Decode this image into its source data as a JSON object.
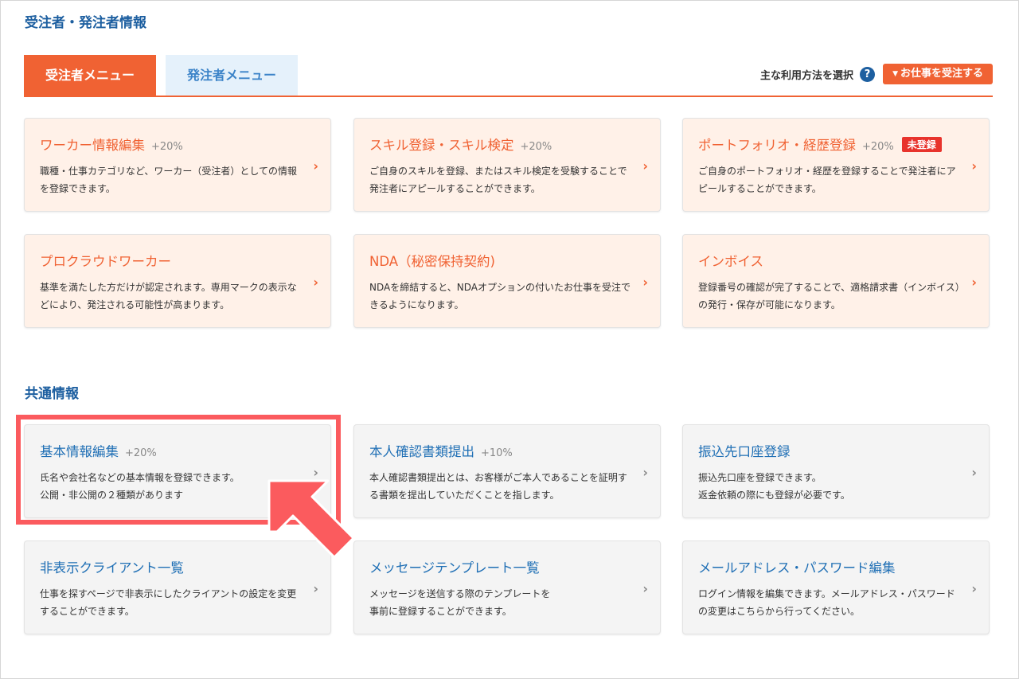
{
  "header": {
    "title": "受注者・発注者情報"
  },
  "tabs": [
    {
      "label": "受注者メニュー",
      "active": true
    },
    {
      "label": "発注者メニュー",
      "active": false
    }
  ],
  "method": {
    "label": "主な利用方法を選択",
    "help_icon": "?",
    "button_caret": "▼",
    "button_label": "お仕事を受注する"
  },
  "worker_cards": [
    {
      "title": "ワーカー情報編集",
      "pct": "+20%",
      "desc": "職種・仕事カテゴリなど、ワーカー（受注者）としての情報を登録できます。"
    },
    {
      "title": "スキル登録・スキル検定",
      "pct": "+20%",
      "desc": "ご自身のスキルを登録、またはスキル検定を受験することで発注者にアピールすることができます。"
    },
    {
      "title": "ポートフォリオ・経歴登録",
      "pct": "+20%",
      "badge": "未登録",
      "desc": "ご自身のポートフォリオ・経歴を登録することで発注者にアピールすることができます。"
    },
    {
      "title": "プロクラウドワーカー",
      "desc": "基準を満たした方だけが認定されます。専用マークの表示などにより、発注される可能性が高まります。"
    },
    {
      "title": "NDA（秘密保持契約)",
      "desc": "NDAを締結すると、NDAオプションの付いたお仕事を受注できるようになります。"
    },
    {
      "title": "インボイス",
      "desc": "登録番号の確認が完了することで、適格請求書（インボイス）の発行・保存が可能になります。"
    }
  ],
  "common": {
    "title": "共通情報",
    "cards": [
      {
        "title": "基本情報編集",
        "pct": "+20%",
        "desc1": "氏名や会社名などの基本情報を登録できます。",
        "desc2": "公開・非公開の２種類があります"
      },
      {
        "title": "本人確認書類提出",
        "pct": "+10%",
        "desc1": "本人確認書類提出とは、お客様がご本人であることを証明する書類を提出していただくことを指します。"
      },
      {
        "title": "振込先口座登録",
        "desc1": "振込先口座を登録できます。",
        "desc2": "返金依頼の際にも登録が必要です。"
      },
      {
        "title": "非表示クライアント一覧",
        "desc1": "仕事を探すページで非表示にしたクライアントの設定を変更することができます。"
      },
      {
        "title": "メッセージテンプレート一覧",
        "desc1": "メッセージを送信する際のテンプレートを",
        "desc2": "事前に登録することができます。"
      },
      {
        "title": "メールアドレス・パスワード編集",
        "desc1": "ログイン情報を編集できます。メールアドレス・パスワードの変更はこちらから行ってください。"
      }
    ]
  },
  "chevron": "›",
  "colors": {
    "accent": "#f06233",
    "link": "#1f6fb5",
    "highlight": "#fb5b5e"
  }
}
